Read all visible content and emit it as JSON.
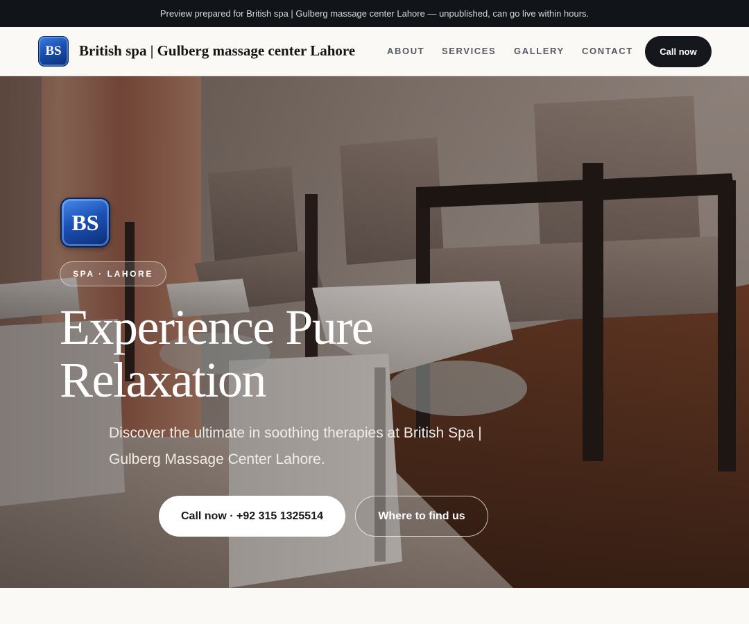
{
  "preview_bar": {
    "text": "Preview prepared for British spa | Gulberg massage center Lahore — unpublished, can go live within hours."
  },
  "header": {
    "logo_text": "BS",
    "brand_name": "British spa | Gulberg massage center Lahore",
    "nav": [
      "ABOUT",
      "SERVICES",
      "GALLERY",
      "CONTACT"
    ],
    "cta_label": "Call now"
  },
  "hero": {
    "logo_text": "BS",
    "badge": "SPA · LAHORE",
    "title_line1": "Experience Pure",
    "title_line2": "Relaxation",
    "subtitle_line1": "Discover the ultimate in soothing therapies at British Spa |",
    "subtitle_line2": "Gulberg Massage Center Lahore.",
    "primary_button": "Call now · +92 315 1325514",
    "secondary_button": "Where to find us"
  },
  "colors": {
    "topbar_bg": "#111418",
    "page_bg": "#faf9f6",
    "cta_bg": "#15171c",
    "logo_blue": "#1b4fb0",
    "nav_text": "#555a63"
  }
}
